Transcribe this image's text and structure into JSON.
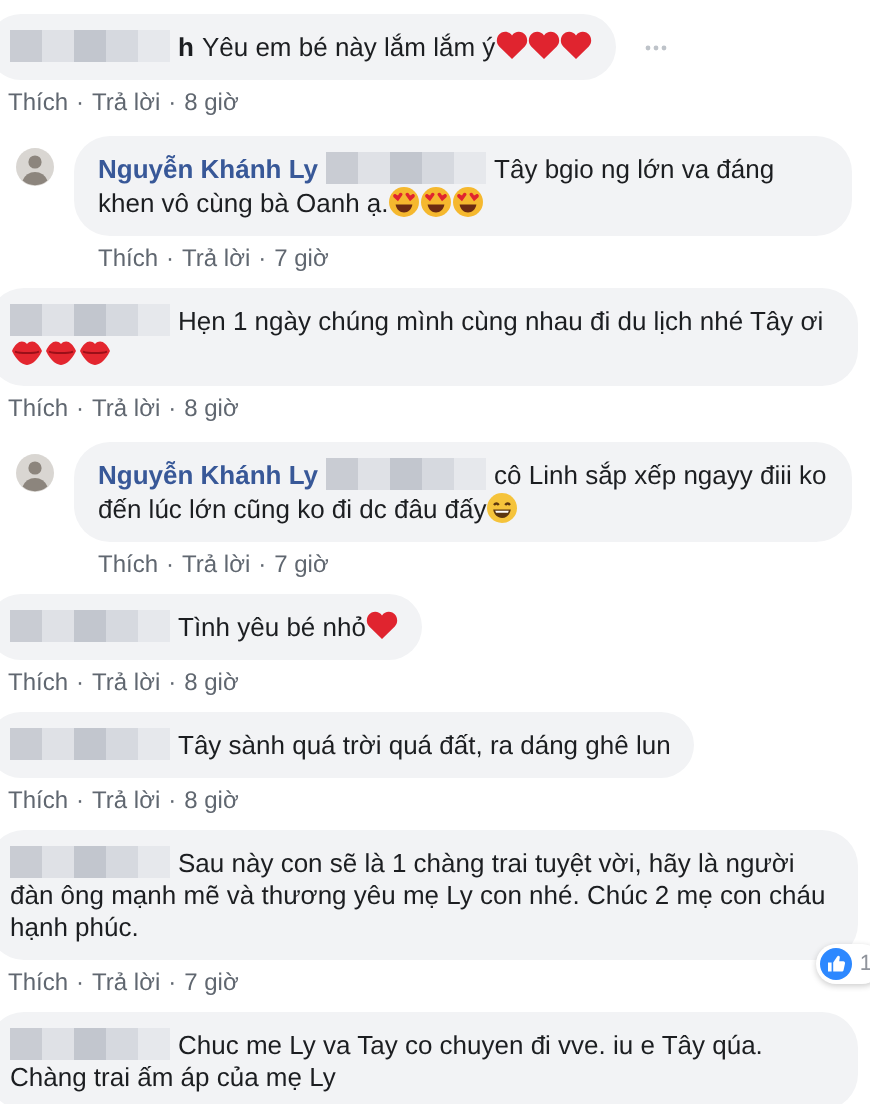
{
  "separator": "·",
  "comments": [
    {
      "kind": "comment",
      "name_blurred": true,
      "name_fragment": "h",
      "text": "Yêu em bé này lắm lắm ý",
      "emojis": [
        {
          "kind": "heart"
        },
        {
          "kind": "heart"
        },
        {
          "kind": "heart"
        }
      ],
      "options_button": true,
      "actions": [
        "Thích",
        "Trả lời"
      ],
      "time": "8 giờ"
    },
    {
      "kind": "reply",
      "name_blurred": true,
      "author": "Nguyễn Khánh Ly",
      "text": "Tây bgio ng lớn va đáng khen vô cùng bà Oanh ạ.",
      "emojis": [
        {
          "kind": "heart-eyes"
        },
        {
          "kind": "heart-eyes"
        },
        {
          "kind": "heart-eyes"
        }
      ],
      "options_button": false,
      "actions": [
        "Thích",
        "Trả lời"
      ],
      "time": "7 giờ"
    },
    {
      "kind": "comment",
      "name_blurred": true,
      "text": "Hẹn 1 ngày chúng mình cùng nhau đi du lịch nhé Tây ơi",
      "emojis": [
        {
          "kind": "lips"
        },
        {
          "kind": "lips"
        },
        {
          "kind": "lips"
        }
      ],
      "options_button": false,
      "actions": [
        "Thích",
        "Trả lời"
      ],
      "time": "8 giờ"
    },
    {
      "kind": "reply",
      "name_blurred": true,
      "author": "Nguyễn Khánh Ly",
      "text": "cô Linh sắp xếp ngayy điii ko đến lúc lớn cũng ko đi dc đâu đấy",
      "emojis": [
        {
          "kind": "smile"
        }
      ],
      "options_button": false,
      "actions": [
        "Thích",
        "Trả lời"
      ],
      "time": "7 giờ"
    },
    {
      "kind": "comment",
      "name_blurred": true,
      "text": "Tình yêu bé nhỏ",
      "emojis": [
        {
          "kind": "heart"
        }
      ],
      "options_button": false,
      "actions": [
        "Thích",
        "Trả lời"
      ],
      "time": "8 giờ"
    },
    {
      "kind": "comment",
      "name_blurred": true,
      "text": "Tây sành quá trời quá đất, ra dáng ghê lun",
      "options_button": false,
      "actions": [
        "Thích",
        "Trả lời"
      ],
      "time": "8 giờ"
    },
    {
      "kind": "comment",
      "name_blurred": true,
      "text": "Sau này con sẽ là 1 chàng trai tuyệt vời, hãy là người đàn ông mạnh mẽ và thương yêu mẹ Ly con nhé. Chúc 2 mẹ con cháu hạnh phúc.",
      "options_button": false,
      "reactions": {
        "count": "1"
      },
      "actions": [
        "Thích",
        "Trả lời"
      ],
      "time": "7 giờ"
    },
    {
      "kind": "comment",
      "name_blurred": true,
      "text": "Chuc me Ly va Tay co chuyen đi vve. iu e Tây qúa. Chàng trai ấm áp của mẹ Ly",
      "options_button": false
    }
  ]
}
